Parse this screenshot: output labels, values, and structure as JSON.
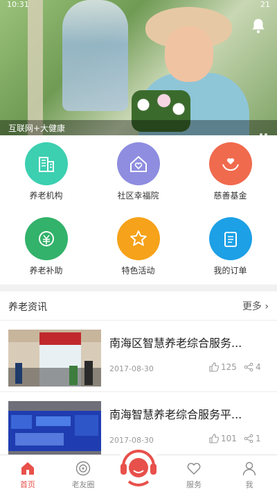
{
  "status_bar": {
    "time": "10:31",
    "battery": "21"
  },
  "hero": {
    "caption": "互联网+大健康"
  },
  "colors": {
    "teal": "#3ccfb0",
    "lavender": "#8e8de0",
    "coral": "#f06a4e",
    "green": "#32b26a",
    "orange": "#f6a21a",
    "blue": "#1da0e6",
    "accent": "#e8504b"
  },
  "grid": [
    {
      "label": "养老机构",
      "icon": "building-icon"
    },
    {
      "label": "社区幸福院",
      "icon": "house-heart-icon"
    },
    {
      "label": "慈善基金",
      "icon": "hands-heart-icon"
    },
    {
      "label": "养老补助",
      "icon": "cash-icon"
    },
    {
      "label": "特色活动",
      "icon": "star-icon"
    },
    {
      "label": "我的订单",
      "icon": "clipboard-icon"
    }
  ],
  "news": {
    "title": "养老资讯",
    "more": "更多",
    "items": [
      {
        "headline": "南海区智慧养老综合服务...",
        "date": "2017-08-30",
        "likes": "125",
        "shares": "4"
      },
      {
        "headline": "南海智慧养老综合服务平...",
        "date": "2017-08-30",
        "likes": "101",
        "shares": "1"
      }
    ]
  },
  "nav": [
    {
      "label": "首页",
      "icon": "home-icon",
      "active": true
    },
    {
      "label": "老友圈",
      "icon": "circle-icon",
      "active": false
    },
    {
      "label": "",
      "icon": "headset-icon",
      "active": false
    },
    {
      "label": "服务",
      "icon": "heart-icon",
      "active": false
    },
    {
      "label": "我",
      "icon": "person-icon",
      "active": false
    }
  ]
}
